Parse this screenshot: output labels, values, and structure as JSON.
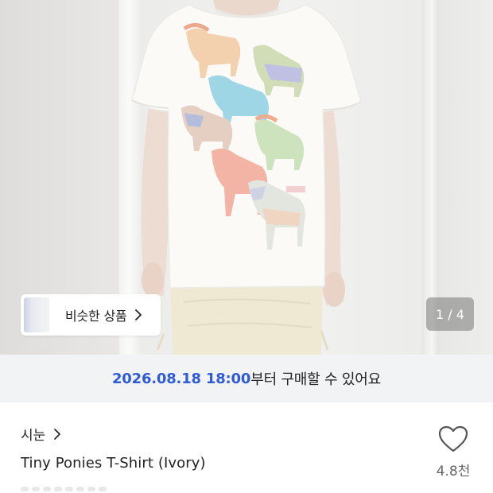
{
  "product_image": {
    "similar_products_label": "비슷한 상품",
    "image_counter": "1 / 4"
  },
  "release_banner": {
    "datetime": "2026.08.18 18:00",
    "suffix": "부터 구매할 수 있어요",
    "accent_color": "#2f5bd6"
  },
  "product": {
    "brand": "시눈",
    "title": "Tiny Ponies T-Shirt (Ivory)",
    "like_count": "4.8천"
  },
  "icons": {
    "similar_chevron": "chevron-right-icon",
    "brand_chevron": "chevron-right-icon",
    "like": "heart-outline-icon"
  }
}
